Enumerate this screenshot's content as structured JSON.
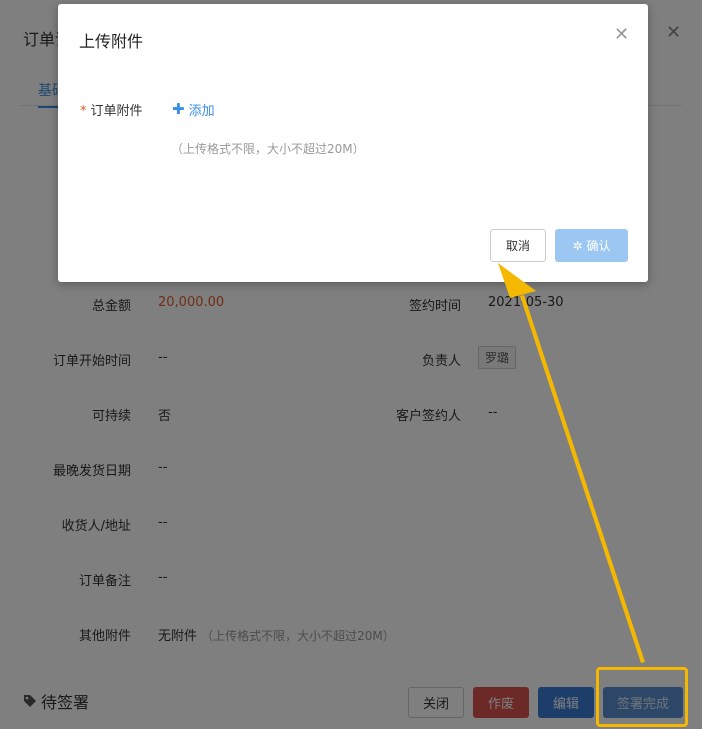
{
  "drawer": {
    "title": "订单详",
    "tab": "基础",
    "fields": {
      "total_label": "总金额",
      "total_value": "20,000.00",
      "sign_time_label": "签约时间",
      "sign_time_value": "2021-05-30",
      "start_label": "订单开始时间",
      "start_value": "--",
      "owner_label": "负责人",
      "owner_value": "罗璐",
      "sustain_label": "可持续",
      "sustain_value": "否",
      "signer_label": "客户签约人",
      "signer_value": "--",
      "ship_label": "最晚发货日期",
      "ship_value": "--",
      "receiver_label": "收货人/地址",
      "receiver_value": "--",
      "remark_label": "订单备注",
      "remark_value": "--",
      "attach_label": "其他附件",
      "attach_value": "无附件",
      "attach_hint": "（上传格式不限，大小不超过20M）"
    },
    "status": "待签署",
    "buttons": {
      "close": "关闭",
      "void": "作废",
      "edit": "编辑",
      "done": "签署完成"
    }
  },
  "modal": {
    "title": "上传附件",
    "label": "订单附件",
    "add": "添加",
    "hint": "（上传格式不限，大小不超过20M）",
    "cancel": "取消",
    "confirm": "确认"
  },
  "colors": {
    "accent": "#3a8ee6",
    "amount": "#e05a2b",
    "annotation": "#f5b800"
  }
}
